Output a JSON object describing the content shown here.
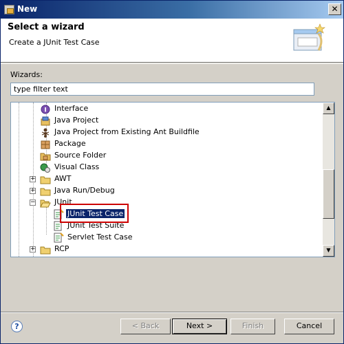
{
  "window": {
    "title": "New",
    "close": "✕"
  },
  "header": {
    "title": "Select a wizard",
    "description": "Create a JUnit Test Case"
  },
  "wizards_label": "Wizards:",
  "filter": {
    "value": "type filter text"
  },
  "tree": {
    "items": [
      {
        "label": "Interface",
        "icon": "interface-icon"
      },
      {
        "label": "Java Project",
        "icon": "java-project-icon"
      },
      {
        "label": "Java Project from Existing Ant Buildfile",
        "icon": "ant-icon"
      },
      {
        "label": "Package",
        "icon": "package-icon"
      },
      {
        "label": "Source Folder",
        "icon": "source-folder-icon"
      },
      {
        "label": "Visual Class",
        "icon": "visual-class-icon"
      },
      {
        "label": "AWT",
        "icon": "folder-icon",
        "expander": "+"
      },
      {
        "label": "Java Run/Debug",
        "icon": "folder-icon",
        "expander": "+"
      },
      {
        "label": "JUnit",
        "icon": "folder-open-icon",
        "expander": "−"
      },
      {
        "label": "JUnit Test Case",
        "icon": "junit-test-icon",
        "selected": true
      },
      {
        "label": "JUnit Test Suite",
        "icon": "junit-suite-icon"
      },
      {
        "label": "Servlet Test Case",
        "icon": "junit-test-icon"
      },
      {
        "label": "RCP",
        "icon": "folder-icon",
        "expander": "+"
      }
    ]
  },
  "scrollbar": {
    "up": "▲",
    "down": "▼"
  },
  "buttons": {
    "help": "?",
    "back": "< Back",
    "next": "Next >",
    "finish": "Finish",
    "cancel": "Cancel"
  },
  "colors": {
    "selection": "#0a246a",
    "highlight_box": "#cc0000",
    "titlebar": "#0a246a"
  }
}
